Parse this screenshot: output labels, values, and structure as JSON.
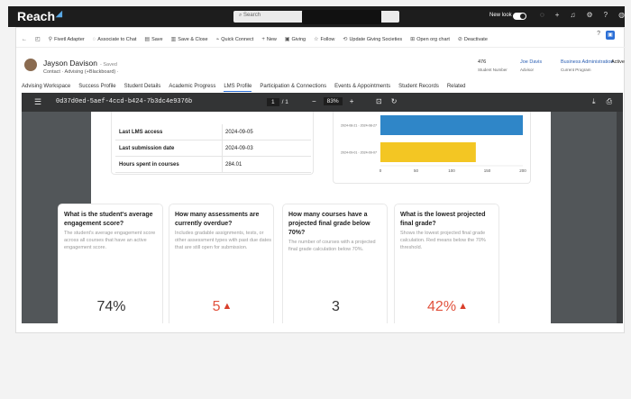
{
  "app": {
    "logo": "Reach",
    "search_placeholder": "Search",
    "new_look_label": "New look"
  },
  "topbar_icons": [
    "bulb-icon",
    "plus-icon",
    "bell-icon",
    "gear-icon",
    "help-icon",
    "account-icon"
  ],
  "commands": [
    {
      "icon": "back-icon",
      "label": ""
    },
    {
      "icon": "window-icon",
      "label": ""
    },
    {
      "icon": "adapter-icon",
      "label": "Fivetl Adapter"
    },
    {
      "icon": "chat-icon",
      "label": "Associate to Chat"
    },
    {
      "icon": "save-icon",
      "label": "Save"
    },
    {
      "icon": "save-close-icon",
      "label": "Save & Close"
    },
    {
      "icon": "connect-icon",
      "label": "Quick Connect"
    },
    {
      "icon": "plus-icon",
      "label": "New"
    },
    {
      "icon": "giving-icon",
      "label": "Giving"
    },
    {
      "icon": "star-icon",
      "label": "Follow"
    },
    {
      "icon": "societies-icon",
      "label": "Update Giving Societies"
    },
    {
      "icon": "org-chart-icon",
      "label": "Open org chart"
    },
    {
      "icon": "deactivate-icon",
      "label": "Deactivate"
    }
  ],
  "record": {
    "name": "Jayson Davison",
    "saved": "- Saved",
    "subtitle": "Contact · Advising (+Blackboard) ·",
    "student_number": "476",
    "student_number_label": "Student Number",
    "advisor": "Joe Davis",
    "advisor_label": "Advisor",
    "program": "Business Administration",
    "program_label": "Current Program",
    "status": "Active",
    "status_label": ""
  },
  "tabs": [
    "Advising Workspace",
    "Success Profile",
    "Student Details",
    "Academic Progress",
    "LMS Profile",
    "Participation & Connections",
    "Events & Appointments",
    "Student Records",
    "Related"
  ],
  "active_tab": "LMS Profile",
  "pdf": {
    "title": "0d37d0ed-5aef-4ccd-b424-7b3dc4e9376b",
    "page_current": "1",
    "page_total": "/ 1",
    "zoom": "83%"
  },
  "lms_table": [
    {
      "k": "Last LMS access",
      "v": "2024-09-05"
    },
    {
      "k": "Last submission date",
      "v": "2024-09-03"
    },
    {
      "k": "Hours spent in courses",
      "v": "284.01"
    }
  ],
  "chart_data": {
    "type": "bar",
    "orientation": "horizontal",
    "categories": [
      "2024-08-21 - 2024-08-27",
      "2024-09-01 - 2024-09-07"
    ],
    "values": [
      200,
      134
    ],
    "colors": [
      "#2f86c8",
      "#f3c623"
    ],
    "xticks": [
      "0",
      "50",
      "100",
      "150",
      "200"
    ],
    "xlim": [
      0,
      200
    ]
  },
  "questions": [
    {
      "title": "What is the student's average engagement score?",
      "desc": "The student's average engagement score across all courses that have an active engagement score.",
      "value": "74%",
      "alert": false
    },
    {
      "title": "How many assessments are currently overdue?",
      "desc": "Includes gradable assignments, tests, or other assessment types with past due dates that are still open for submission.",
      "value": "5",
      "alert": true
    },
    {
      "title": "How many courses have a projected final grade below 70%?",
      "desc": "The number of courses with a projected final grade calculation below 70%.",
      "value": "3",
      "alert": false
    },
    {
      "title": "What is the lowest projected final grade?",
      "desc": "Shows the lowest projected final grade calculation. Red means below the 70% threshold.",
      "value": "42%",
      "alert": true
    }
  ]
}
